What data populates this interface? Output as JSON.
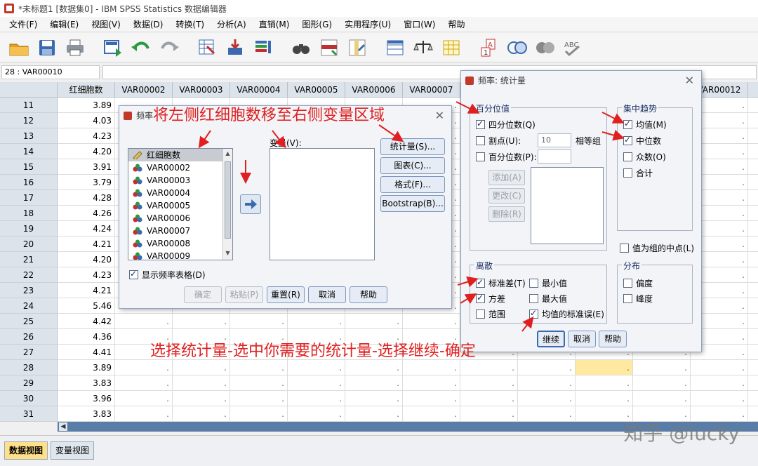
{
  "window": {
    "title": "*未标题1 [数据集0] - IBM SPSS Statistics 数据编辑器"
  },
  "menu": [
    "文件(F)",
    "编辑(E)",
    "视图(V)",
    "数据(D)",
    "转换(T)",
    "分析(A)",
    "直销(M)",
    "图形(G)",
    "实用程序(U)",
    "窗口(W)",
    "帮助"
  ],
  "toolbar_icons": [
    "open-folder-icon",
    "save-icon",
    "print-icon",
    "dialog-recall-icon",
    "undo-icon",
    "redo-icon",
    "goto-case-icon",
    "goto-variable-icon",
    "variables-icon",
    "find-icon",
    "insert-cases-icon",
    "insert-variable-icon",
    "split-file-icon",
    "weight-cases-icon",
    "select-cases-icon",
    "value-labels-icon",
    "use-sets-icon",
    "show-all-icon",
    "spell-check-icon"
  ],
  "refbar": {
    "cell_ref": "28 : VAR00010"
  },
  "grid": {
    "columns": [
      "红细胞数",
      "VAR00002",
      "VAR00003",
      "VAR00004",
      "VAR00005",
      "VAR00006",
      "VAR00007",
      "",
      "",
      "",
      "",
      "VAR00012",
      ""
    ],
    "rows": [
      {
        "n": "11",
        "v": "3.89"
      },
      {
        "n": "12",
        "v": "4.03"
      },
      {
        "n": "13",
        "v": "4.23"
      },
      {
        "n": "14",
        "v": "4.20"
      },
      {
        "n": "15",
        "v": "3.91"
      },
      {
        "n": "16",
        "v": "3.79"
      },
      {
        "n": "17",
        "v": "4.28"
      },
      {
        "n": "18",
        "v": "4.26"
      },
      {
        "n": "19",
        "v": "4.24"
      },
      {
        "n": "20",
        "v": "4.21"
      },
      {
        "n": "21",
        "v": "4.20"
      },
      {
        "n": "22",
        "v": "4.23"
      },
      {
        "n": "23",
        "v": "4.21"
      },
      {
        "n": "24",
        "v": "5.46"
      },
      {
        "n": "25",
        "v": "4.42"
      },
      {
        "n": "26",
        "v": "4.36"
      },
      {
        "n": "27",
        "v": "4.41"
      },
      {
        "n": "28",
        "v": "3.89"
      },
      {
        "n": "29",
        "v": "3.83"
      },
      {
        "n": "30",
        "v": "3.96"
      },
      {
        "n": "31",
        "v": "3.83"
      }
    ],
    "empty_marker": "."
  },
  "tabs": {
    "data_view": "数据视图",
    "variable_view": "变量视图"
  },
  "watermark": "知乎 @lucky",
  "freq_dialog": {
    "title": "频率",
    "variables": [
      "红细胞数",
      "VAR00002",
      "VAR00003",
      "VAR00004",
      "VAR00005",
      "VAR00006",
      "VAR00007",
      "VAR00008",
      "VAR00009"
    ],
    "target_label": "变量(V):",
    "side_buttons": [
      "统计量(S)...",
      "图表(C)...",
      "格式(F)...",
      "Bootstrap(B)..."
    ],
    "show_table_label": "显示频率表格(D)",
    "bottom_buttons": [
      "确定",
      "粘贴(P)",
      "重置(R)",
      "取消",
      "帮助"
    ]
  },
  "stat_dialog": {
    "title": "频率: 统计量",
    "percentile_group": "百分位值",
    "quartiles": "四分位数(Q)",
    "cut_points": "割点(U):",
    "cut_value": "10",
    "equal_groups": "相等组",
    "percentiles": "百分位数(P):",
    "add": "添加(A)",
    "change": "更改(C)",
    "remove": "删除(R)",
    "central_group": "集中趋势",
    "mean": "均值(M)",
    "median": "中位数",
    "mode": "众数(O)",
    "sum": "合计",
    "midpoint": "值为组的中点(L)",
    "dispersion_group": "离散",
    "std": "标准差(T)",
    "min": "最小值",
    "variance": "方差",
    "max": "最大值",
    "range": "范围",
    "se_mean": "均值的标准误(E)",
    "distribution_group": "分布",
    "skewness": "偏度",
    "kurtosis": "峰度",
    "buttons": [
      "继续",
      "取消",
      "帮助"
    ]
  },
  "annotations": {
    "top": "将左侧红细胞数移至右侧变量区域",
    "bottom": "选择统计量-选中你需要的统计量-选择继续-确定"
  },
  "colors": {
    "annotation": "#e02020",
    "highlight_cell": "#ffe8a0",
    "active_tab": "#ffe08a"
  }
}
